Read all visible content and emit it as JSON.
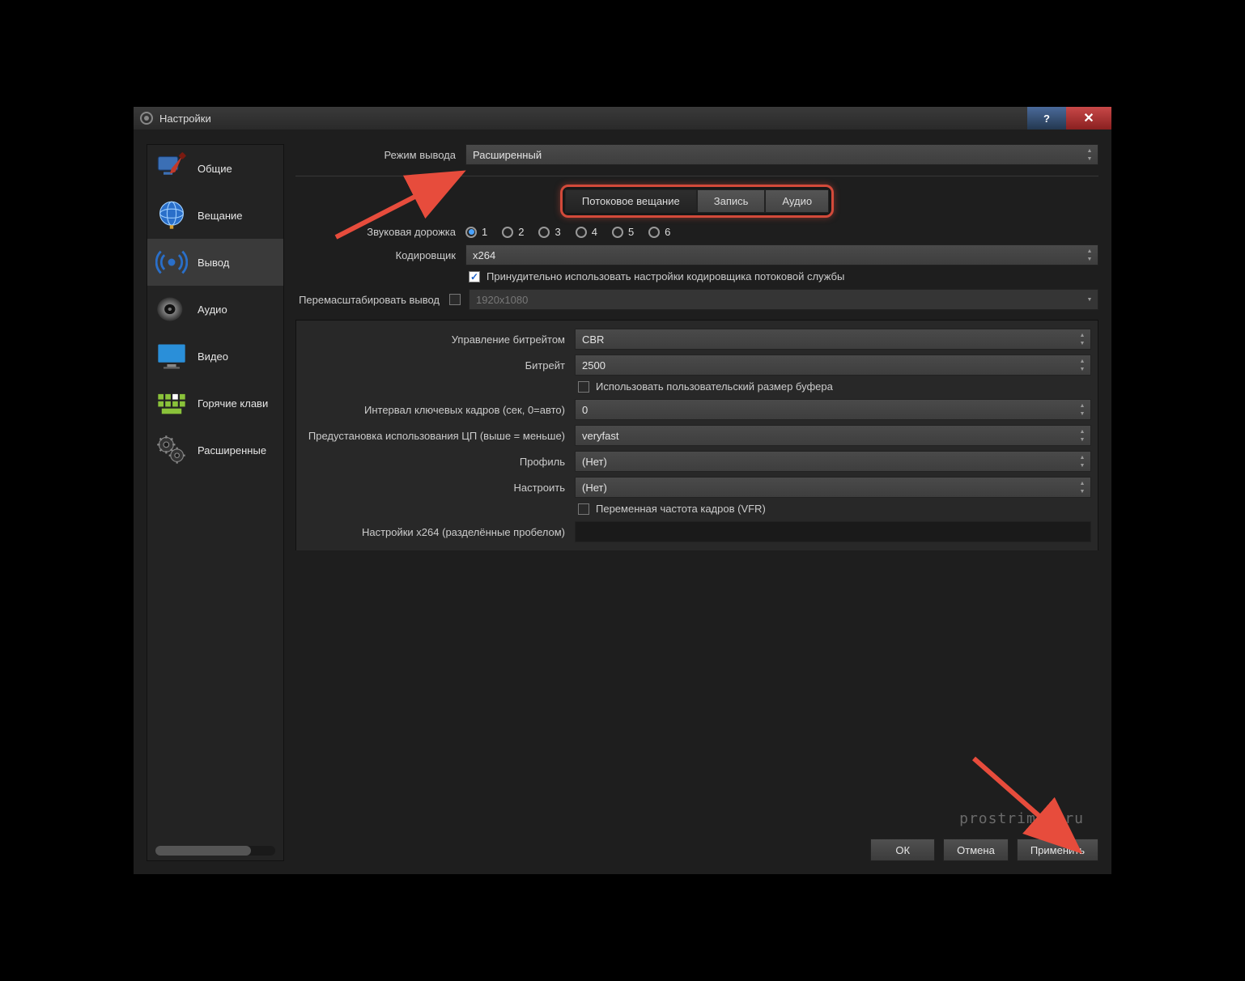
{
  "title": "Настройки",
  "sidebar": {
    "items": [
      {
        "label": "Общие"
      },
      {
        "label": "Вещание"
      },
      {
        "label": "Вывод"
      },
      {
        "label": "Аудио"
      },
      {
        "label": "Видео"
      },
      {
        "label": "Горячие клави"
      },
      {
        "label": "Расширенные"
      }
    ]
  },
  "outputMode": {
    "label": "Режим вывода",
    "value": "Расширенный"
  },
  "tabs": {
    "streaming": "Потоковое вещание",
    "recording": "Запись",
    "audio": "Аудио"
  },
  "audioTrack": {
    "label": "Звуковая дорожка",
    "opts": [
      "1",
      "2",
      "3",
      "4",
      "5",
      "6"
    ],
    "selected": "1"
  },
  "encoder": {
    "label": "Кодировщик",
    "value": "x264"
  },
  "enforce": {
    "label": "Принудительно использовать настройки кодировщика потоковой службы"
  },
  "rescale": {
    "label": "Перемасштабировать вывод",
    "placeholder": "1920x1080"
  },
  "panel": {
    "rateControl": {
      "label": "Управление битрейтом",
      "value": "CBR"
    },
    "bitrate": {
      "label": "Битрейт",
      "value": "2500"
    },
    "customBuffer": {
      "label": "Использовать пользовательский размер буфера"
    },
    "keyint": {
      "label": "Интервал ключевых кадров (сек, 0=авто)",
      "value": "0"
    },
    "cpuPreset": {
      "label": "Предустановка использования ЦП (выше = меньше)",
      "value": "veryfast"
    },
    "profile": {
      "label": "Профиль",
      "value": "(Нет)"
    },
    "tune": {
      "label": "Настроить",
      "value": "(Нет)"
    },
    "vfr": {
      "label": "Переменная частота кадров (VFR)"
    },
    "x264opts": {
      "label": "Настройки x264 (разделённые пробелом)",
      "value": ""
    }
  },
  "buttons": {
    "ok": "ОК",
    "cancel": "Отмена",
    "apply": "Применить"
  },
  "watermark": "prostrimer.ru"
}
